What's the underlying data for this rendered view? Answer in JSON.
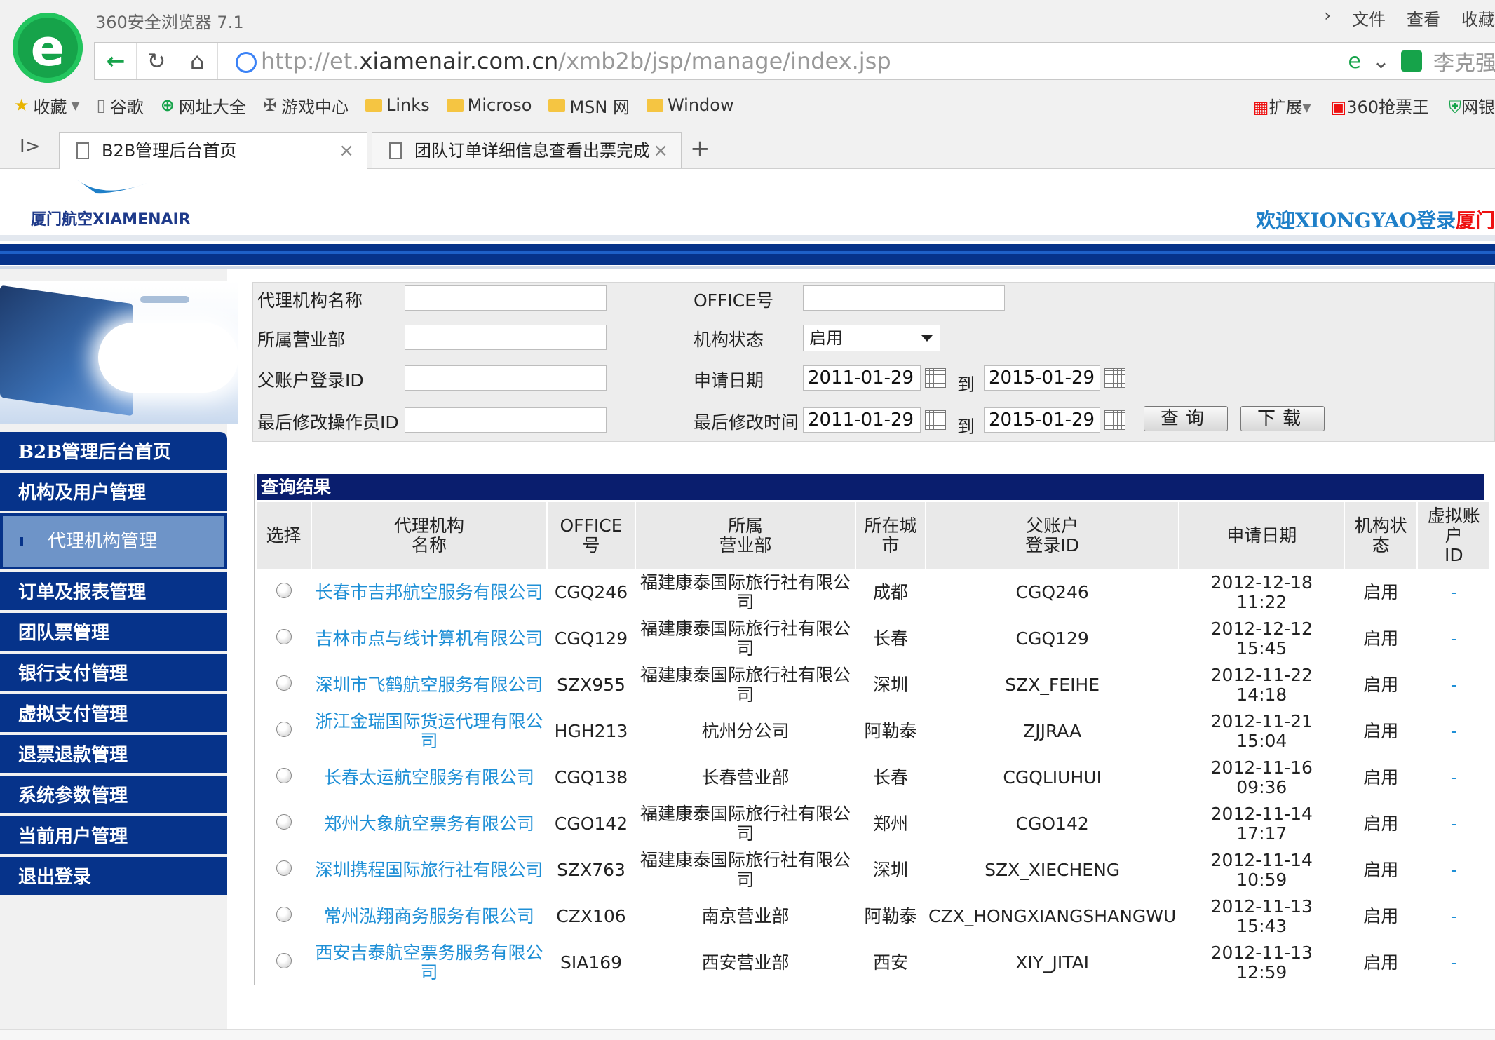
{
  "browser": {
    "app_title": "360安全浏览器 7.1",
    "menu": [
      "文件",
      "查看",
      "收藏"
    ],
    "url_prefix": "http://et.",
    "url_domain": "xiamenair.com.cn",
    "url_path": "/xmb2b/jsp/manage/index.jsp",
    "user": "李克强",
    "bookmarks": [
      "收藏",
      "谷歌",
      "网址大全",
      "游戏中心",
      "Links",
      "Microso",
      "MSN 网",
      "Window"
    ],
    "bookmarks_right": [
      "扩展",
      "360抢票王",
      "网银"
    ],
    "tabs": [
      {
        "label": "B2B管理后台首页",
        "active": true
      },
      {
        "label": "团队订单详细信息查看出票完成",
        "active": false
      }
    ]
  },
  "header": {
    "logo_text": "厦门航空XIAMENAIR",
    "welcome_prefix": "欢迎XIONGYAO登录",
    "welcome_suffix": "厦门"
  },
  "sidebar": {
    "items": [
      {
        "label": "B2B管理后台首页"
      },
      {
        "label": "机构及用户管理"
      },
      {
        "label": "代理机构管理",
        "sub": true
      },
      {
        "label": "订单及报表管理"
      },
      {
        "label": "团队票管理"
      },
      {
        "label": "银行支付管理"
      },
      {
        "label": "虚拟支付管理"
      },
      {
        "label": "退票退款管理"
      },
      {
        "label": "系统参数管理"
      },
      {
        "label": "当前用户管理"
      },
      {
        "label": "退出登录"
      }
    ]
  },
  "form": {
    "agency_name_label": "代理机构名称",
    "office_label": "OFFICE号",
    "branch_label": "所属营业部",
    "status_label": "机构状态",
    "status_value": "启用",
    "parent_id_label": "父账户登录ID",
    "apply_date_label": "申请日期",
    "apply_from": "2011-01-29",
    "apply_to": "2015-01-29",
    "to_label": "到",
    "last_operator_label": "最后修改操作员ID",
    "last_modified_label": "最后修改时间",
    "mod_from": "2011-01-29",
    "mod_to": "2015-01-29",
    "query_button": "查询",
    "download_button": "下载"
  },
  "results": {
    "title": "查询结果",
    "columns": [
      {
        "line1": "选择",
        "line2": ""
      },
      {
        "line1": "代理机构",
        "line2": "名称"
      },
      {
        "line1": "OFFICE",
        "line2": "号"
      },
      {
        "line1": "所属",
        "line2": "营业部"
      },
      {
        "line1": "所在城",
        "line2": "市"
      },
      {
        "line1": "父账户",
        "line2": "登录ID"
      },
      {
        "line1": "申请日期",
        "line2": ""
      },
      {
        "line1": "机构状",
        "line2": "态"
      },
      {
        "line1": "虚拟账户",
        "line2": "ID"
      }
    ],
    "rows": [
      {
        "name": "长春市吉邦航空服务有限公司",
        "office": "CGQ246",
        "branch": "福建康泰国际旅行社有限公司",
        "city": "成都",
        "parent_id": "CGQ246",
        "date": "2012-12-18",
        "time": "11:22",
        "status": "启用",
        "vaccount": "-"
      },
      {
        "name": "吉林市点与线计算机有限公司",
        "office": "CGQ129",
        "branch": "福建康泰国际旅行社有限公司",
        "city": "长春",
        "parent_id": "CGQ129",
        "date": "2012-12-12",
        "time": "15:45",
        "status": "启用",
        "vaccount": "-"
      },
      {
        "name": "深圳市飞鹤航空服务有限公司",
        "office": "SZX955",
        "branch": "福建康泰国际旅行社有限公司",
        "city": "深圳",
        "parent_id": "SZX_FEIHE",
        "date": "2012-11-22",
        "time": "14:18",
        "status": "启用",
        "vaccount": "-"
      },
      {
        "name": "浙江金瑞国际货运代理有限公司",
        "office": "HGH213",
        "branch": "杭州分公司",
        "city": "阿勒泰",
        "parent_id": "ZJJRAA",
        "date": "2012-11-21",
        "time": "15:04",
        "status": "启用",
        "vaccount": "-"
      },
      {
        "name": "长春太运航空服务有限公司",
        "office": "CGQ138",
        "branch": "长春营业部",
        "city": "长春",
        "parent_id": "CGQLIUHUI",
        "date": "2012-11-16",
        "time": "09:36",
        "status": "启用",
        "vaccount": "-"
      },
      {
        "name": "郑州大象航空票务有限公司",
        "office": "CGO142",
        "branch": "福建康泰国际旅行社有限公司",
        "city": "郑州",
        "parent_id": "CGO142",
        "date": "2012-11-14",
        "time": "17:17",
        "status": "启用",
        "vaccount": "-"
      },
      {
        "name": "深圳携程国际旅行社有限公司",
        "office": "SZX763",
        "branch": "福建康泰国际旅行社有限公司",
        "city": "深圳",
        "parent_id": "SZX_XIECHENG",
        "date": "2012-11-14",
        "time": "10:59",
        "status": "启用",
        "vaccount": "-"
      },
      {
        "name": "常州泓翔商务服务有限公司",
        "office": "CZX106",
        "branch": "南京营业部",
        "city": "阿勒泰",
        "parent_id": "CZX_HONGXIANGSHANGWU",
        "date": "2012-11-13",
        "time": "15:43",
        "status": "启用",
        "vaccount": "-"
      },
      {
        "name": "西安吉泰航空票务服务有限公司",
        "office": "SIA169",
        "branch": "西安营业部",
        "city": "西安",
        "parent_id": "XIY_JITAI",
        "date": "2012-11-13",
        "time": "12:59",
        "status": "启用",
        "vaccount": "-"
      }
    ]
  },
  "colors": {
    "nav_blue": "#06338a",
    "sub_blue": "#6e94c8",
    "link_blue": "#1e8fd6",
    "title_navy": "#0a1e6e"
  }
}
